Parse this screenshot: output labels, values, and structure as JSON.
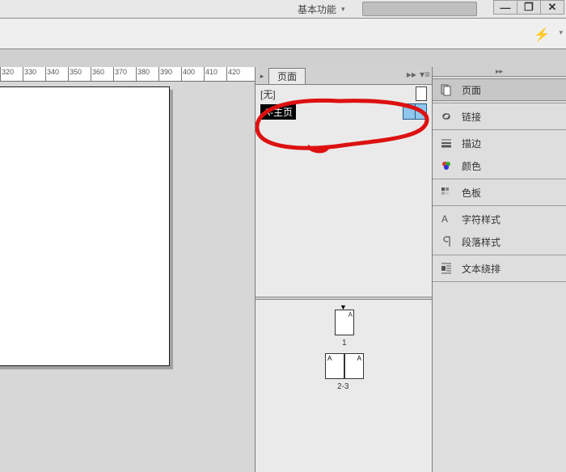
{
  "topbar": {
    "workspace_label": "基本功能",
    "search_placeholder": "",
    "winbtns": {
      "min": "—",
      "max": "❐",
      "close": "✕"
    }
  },
  "ruler": {
    "start": 320,
    "end": 420,
    "step": 10
  },
  "pages_panel": {
    "tab_label": "页面",
    "master_none": "[无]",
    "master_a": "A-主页",
    "page1_label": "1",
    "spread_label": "2-3",
    "page_marker": "▼",
    "applied_master_letter": "A"
  },
  "dock": {
    "groups": [
      {
        "items": [
          {
            "id": "pages",
            "label": "页面",
            "icon": "pages-icon",
            "active": true
          }
        ]
      },
      {
        "items": [
          {
            "id": "links",
            "label": "链接",
            "icon": "links-icon"
          }
        ]
      },
      {
        "items": [
          {
            "id": "stroke",
            "label": "描边",
            "icon": "stroke-icon"
          },
          {
            "id": "color",
            "label": "颜色",
            "icon": "color-icon"
          }
        ]
      },
      {
        "items": [
          {
            "id": "swatches",
            "label": "色板",
            "icon": "swatches-icon"
          }
        ]
      },
      {
        "items": [
          {
            "id": "charstyles",
            "label": "字符样式",
            "icon": "charstyles-icon"
          },
          {
            "id": "parastyles",
            "label": "段落样式",
            "icon": "parastyles-icon"
          }
        ]
      },
      {
        "items": [
          {
            "id": "textwrap",
            "label": "文本绕排",
            "icon": "textwrap-icon"
          }
        ]
      }
    ]
  }
}
